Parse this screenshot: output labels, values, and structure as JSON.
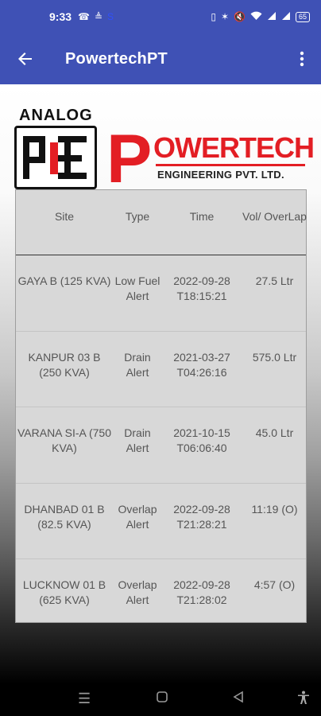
{
  "status_bar": {
    "time": "9:33",
    "left_icons": [
      "whatsapp-icon",
      "notification-icon",
      "app-icon"
    ],
    "right_icons": [
      "vibrate-icon",
      "bluetooth-icon",
      "mute-icon",
      "wifi-icon",
      "signal-icon",
      "signal-icon"
    ],
    "battery": "65"
  },
  "app_bar": {
    "title": "PowertechPT",
    "back_icon": "arrow-back-icon",
    "menu_icon": "more-vert-icon"
  },
  "logo": {
    "analog": "ANALOG",
    "p": "P",
    "owertech": "OWERTECH",
    "engineering": "ENGINEERING PVT. LTD."
  },
  "table": {
    "headers": {
      "site": "Site",
      "type": "Type",
      "time": "Time",
      "vol": "Vol/ OverLap"
    },
    "rows": [
      {
        "site": "GAYA B (125 KVA)",
        "type": "Low Fuel Alert",
        "time": "2022-09-28 T18:15:21",
        "vol": "27.5 Ltr"
      },
      {
        "site": "KANPUR 03 B (250 KVA)",
        "type": "Drain Alert",
        "time": "2021-03-27 T04:26:16",
        "vol": "575.0 Ltr"
      },
      {
        "site": "VARANA SI-A (750 KVA)",
        "type": "Drain Alert",
        "time": "2021-10-15 T06:06:40",
        "vol": "45.0 Ltr"
      },
      {
        "site": "DHANBAD 01 B (82.5 KVA)",
        "type": "Overlap Alert",
        "time": "2022-09-28 T21:28:21",
        "vol": "11:19 (O)"
      },
      {
        "site": "LUCKNOW 01 B (625 KVA)",
        "type": "Overlap Alert",
        "time": "2022-09-28 T21:28:02",
        "vol": "4:57 (O)"
      }
    ]
  },
  "nav_bar": {
    "items": [
      "recents-icon",
      "home-icon",
      "back-icon",
      "accessibility-icon"
    ]
  },
  "colors": {
    "primary": "#3f51b5",
    "brand_red": "#e31e24"
  }
}
